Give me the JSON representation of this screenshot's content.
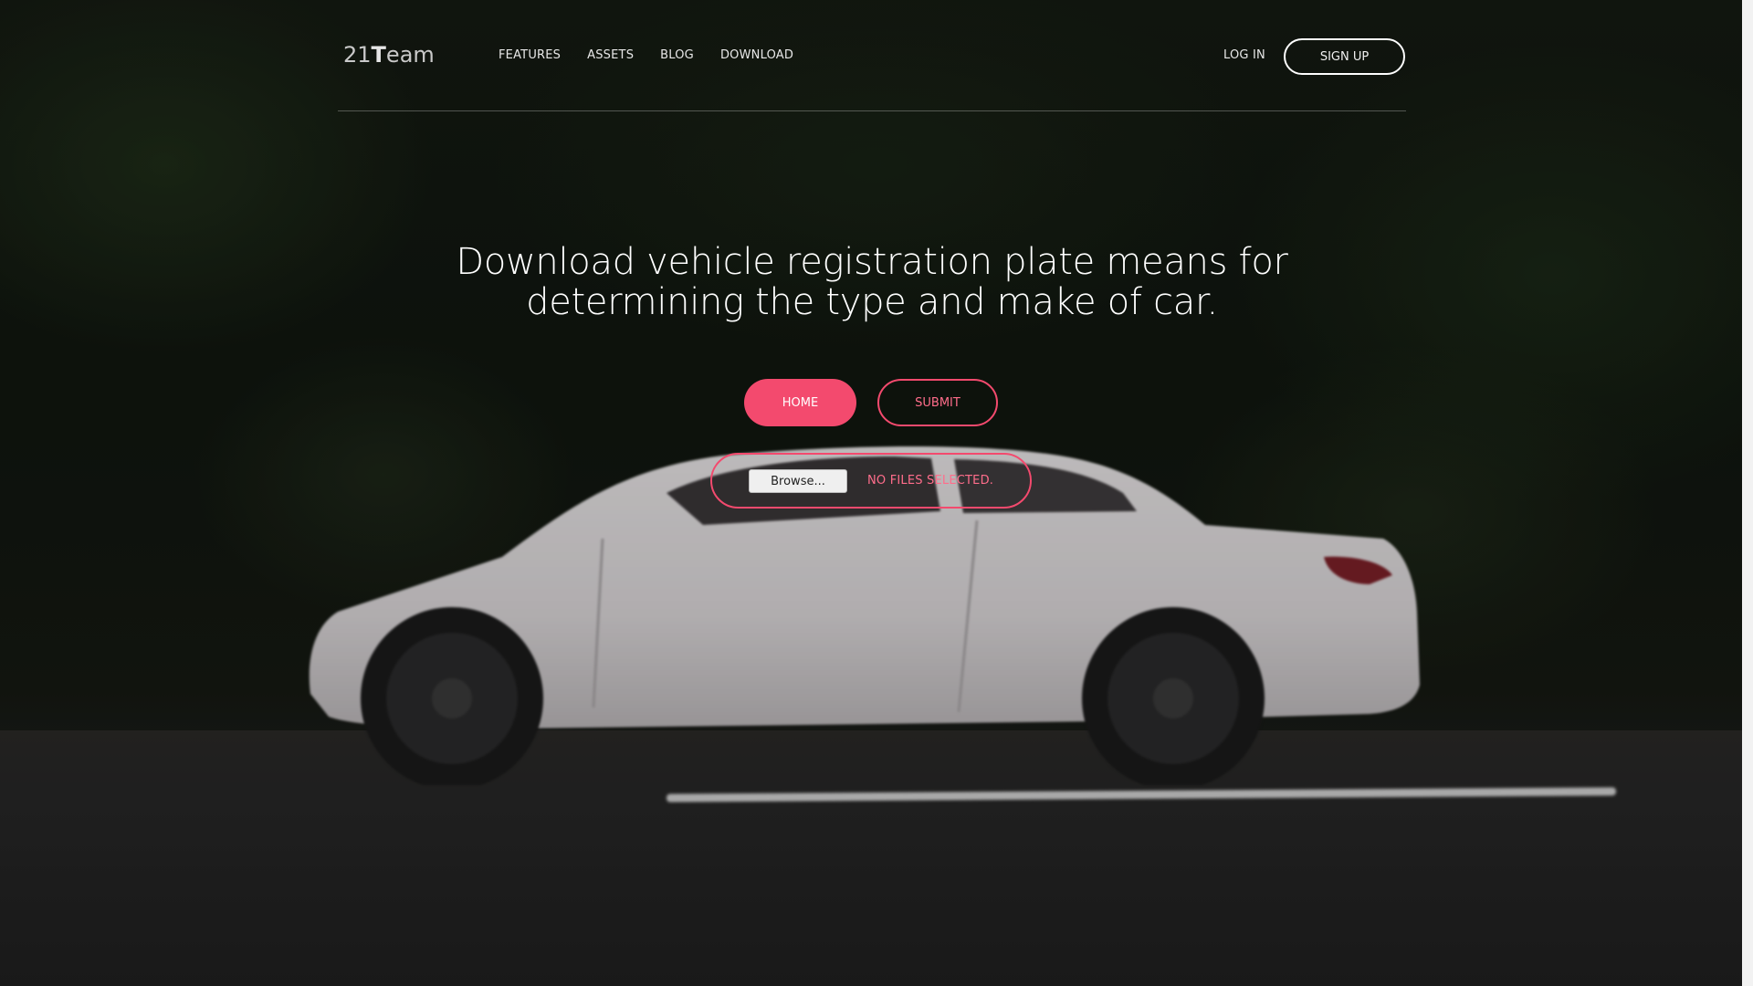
{
  "nav": {
    "logo_prefix": "21",
    "logo_bold": "T",
    "logo_suffix": "eam",
    "links": [
      "FEATURES",
      "ASSETS",
      "BLOG",
      "DOWNLOAD"
    ],
    "login": "LOG IN",
    "signup": "SIGN UP"
  },
  "hero": {
    "title_line1": "Download vehicle registration plate means for",
    "title_line2": "determining the type and make of car.",
    "home_button": "HOME",
    "submit_button": "SUBMIT",
    "browse_button": "Browse...",
    "file_status": "NO FILES SELECTED."
  },
  "colors": {
    "accent": "#f34a6e",
    "accent_text": "#ff6d8b"
  }
}
